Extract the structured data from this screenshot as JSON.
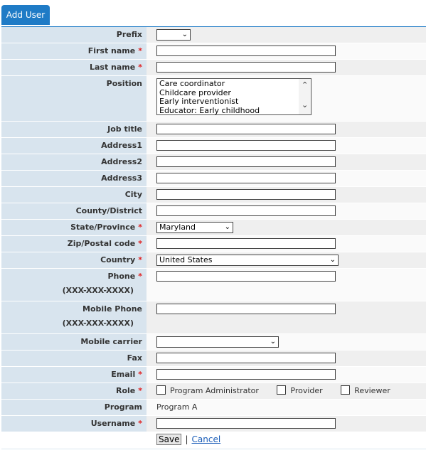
{
  "tab": {
    "label": "Add User"
  },
  "fields": {
    "prefix": "Prefix",
    "first_name": "First name",
    "last_name": "Last name",
    "position": "Position",
    "job_title": "Job title",
    "address1": "Address1",
    "address2": "Address2",
    "address3": "Address3",
    "city": "City",
    "county": "County/District",
    "state": "State/Province",
    "zip": "Zip/Postal code",
    "country": "Country",
    "phone": "Phone",
    "phone_format": "(XXX-XXX-XXXX)",
    "mobile_phone": "Mobile Phone",
    "mobile_phone_format": "(XXX-XXX-XXXX)",
    "mobile_carrier": "Mobile carrier",
    "fax": "Fax",
    "email": "Email",
    "role": "Role",
    "program": "Program",
    "username": "Username"
  },
  "required_mark": "*",
  "position_options": [
    "Care coordinator",
    "Childcare provider",
    "Early interventionist",
    "Educator: Early childhood"
  ],
  "state_value": "Maryland",
  "country_value": "United States",
  "roles": [
    "Program Administrator",
    "Provider",
    "Reviewer"
  ],
  "program_value": "Program A",
  "actions": {
    "save": "Save",
    "separator": "|",
    "cancel": "Cancel"
  }
}
